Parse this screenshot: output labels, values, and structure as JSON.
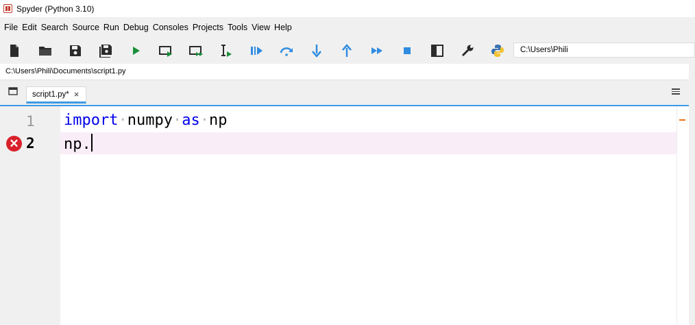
{
  "window": {
    "title": "Spyder (Python 3.10)"
  },
  "menu": [
    "File",
    "Edit",
    "Search",
    "Source",
    "Run",
    "Debug",
    "Consoles",
    "Projects",
    "Tools",
    "View",
    "Help"
  ],
  "toolbar": {
    "working_directory": "C:\\Users\\Phili",
    "buttons": [
      "new-file-icon",
      "open-file-icon",
      "save-icon",
      "save-all-icon",
      "run-icon",
      "run-cell-icon",
      "run-cell-advance-icon",
      "run-selection-icon",
      "debug-icon",
      "step-over-icon",
      "step-into-icon",
      "step-return-icon",
      "continue-icon",
      "stop-icon",
      "maximize-pane-icon",
      "preferences-icon",
      "python-path-icon"
    ],
    "colors": {
      "run": "#1a8f3a",
      "debug": "#2f8ce0"
    }
  },
  "editor": {
    "file_path": "C:\\Users\\Phili\\Documents\\script1.py",
    "tab_label": "script1.py*",
    "tab_close": "×",
    "lines": [
      {
        "number": "1",
        "code": {
          "kw1": "import",
          "name1": "numpy",
          "kw2": "as",
          "name2": "np"
        }
      },
      {
        "number": "2",
        "code": {
          "text": "np."
        },
        "error": true
      }
    ],
    "error_glyph": "✕"
  }
}
